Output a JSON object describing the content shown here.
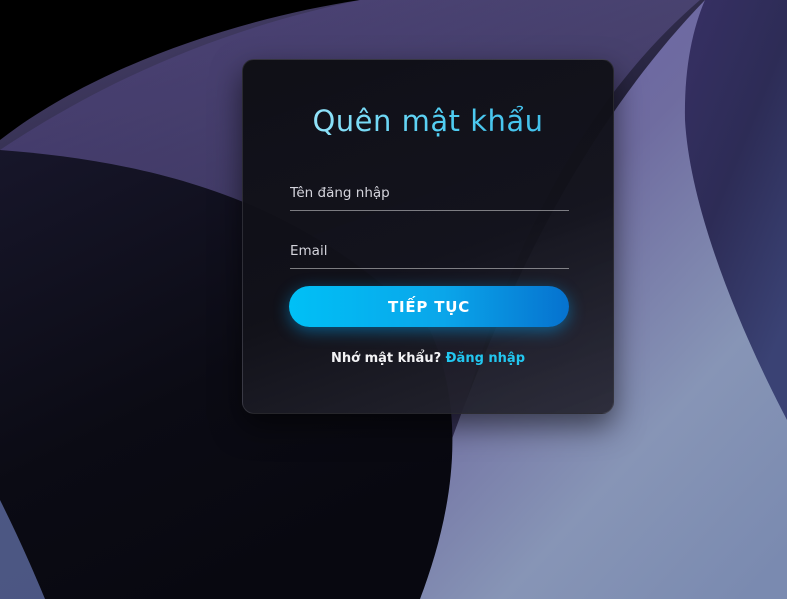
{
  "form": {
    "title": "Quên mật khẩu",
    "username_placeholder": "Tên đăng nhập",
    "username_value": "",
    "email_placeholder": "Email",
    "email_value": "",
    "submit_label": "TIẾP TỤC",
    "remember_text": "Nhớ mật khẩu?",
    "login_link_label": "Đăng nhập"
  },
  "colors": {
    "title_accent": "#4fcdf2",
    "button_start": "#00c0f6",
    "button_end": "#0672cf",
    "link": "#22c7f0",
    "card_background": "#0e0e14"
  }
}
